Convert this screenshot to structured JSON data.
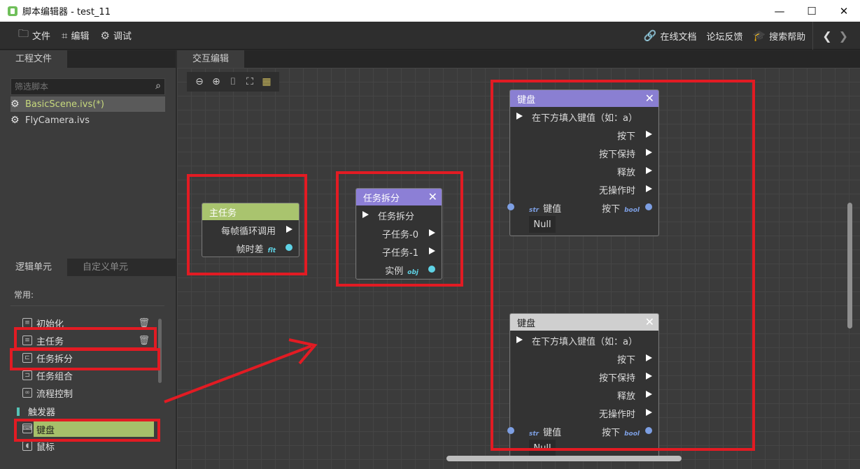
{
  "window": {
    "title": "脚本编辑器 - test_11",
    "min": "—",
    "max": "☐",
    "close": "✕"
  },
  "menu": {
    "file": "文件",
    "edit": "编辑",
    "debug": "调试",
    "online_docs": "在线文档",
    "forum": "论坛反馈",
    "help": "搜索帮助",
    "back": "❮",
    "forward": "❯"
  },
  "project": {
    "tab": "工程文件",
    "search_placeholder": "筛选脚本",
    "files": [
      "BasicScene.ivs(*)",
      "FlyCamera.ivs"
    ]
  },
  "logic": {
    "tabs": [
      "逻辑单元",
      "自定义单元"
    ],
    "common_label": "常用:",
    "items": [
      "初始化",
      "主任务",
      "任务拆分",
      "任务组合",
      "流程控制"
    ],
    "category_trigger": "触发器",
    "trigger_items": [
      "键盘",
      "鼠标"
    ]
  },
  "editor": {
    "tab": "交互编辑"
  },
  "nodes": {
    "main_task": {
      "title": "主任务",
      "rows": [
        "每帧循环调用",
        "帧时差"
      ],
      "type_flt": "flt"
    },
    "task_split": {
      "title": "任务拆分",
      "in_label": "任务拆分",
      "rows": [
        "子任务-0",
        "子任务-1",
        "实例"
      ],
      "type_obj": "obj"
    },
    "keyboard1": {
      "title": "键盘",
      "in_label": "在下方填入键值（如：a）",
      "outs": [
        "按下",
        "按下保持",
        "释放",
        "无操作时"
      ],
      "key_label": "键值",
      "type_str": "str",
      "press_label": "按下",
      "type_bool": "bool",
      "value": "Null"
    },
    "keyboard2": {
      "title": "键盘",
      "in_label": "在下方填入键值（如：a）",
      "outs": [
        "按下",
        "按下保持",
        "释放",
        "无操作时"
      ],
      "key_label": "键值",
      "type_str": "str",
      "press_label": "按下",
      "type_bool": "bool",
      "value": "Null"
    }
  },
  "colors": {
    "main_task_header": "#a9c46e",
    "split_header": "#8c7fd6",
    "keyboard_header": "#8a7fd2",
    "keyboard2_header": "#cfcfcf",
    "annotation_red": "#e21b23",
    "port_cyan": "#5fd3e6",
    "port_blue": "#7d9fe3"
  }
}
